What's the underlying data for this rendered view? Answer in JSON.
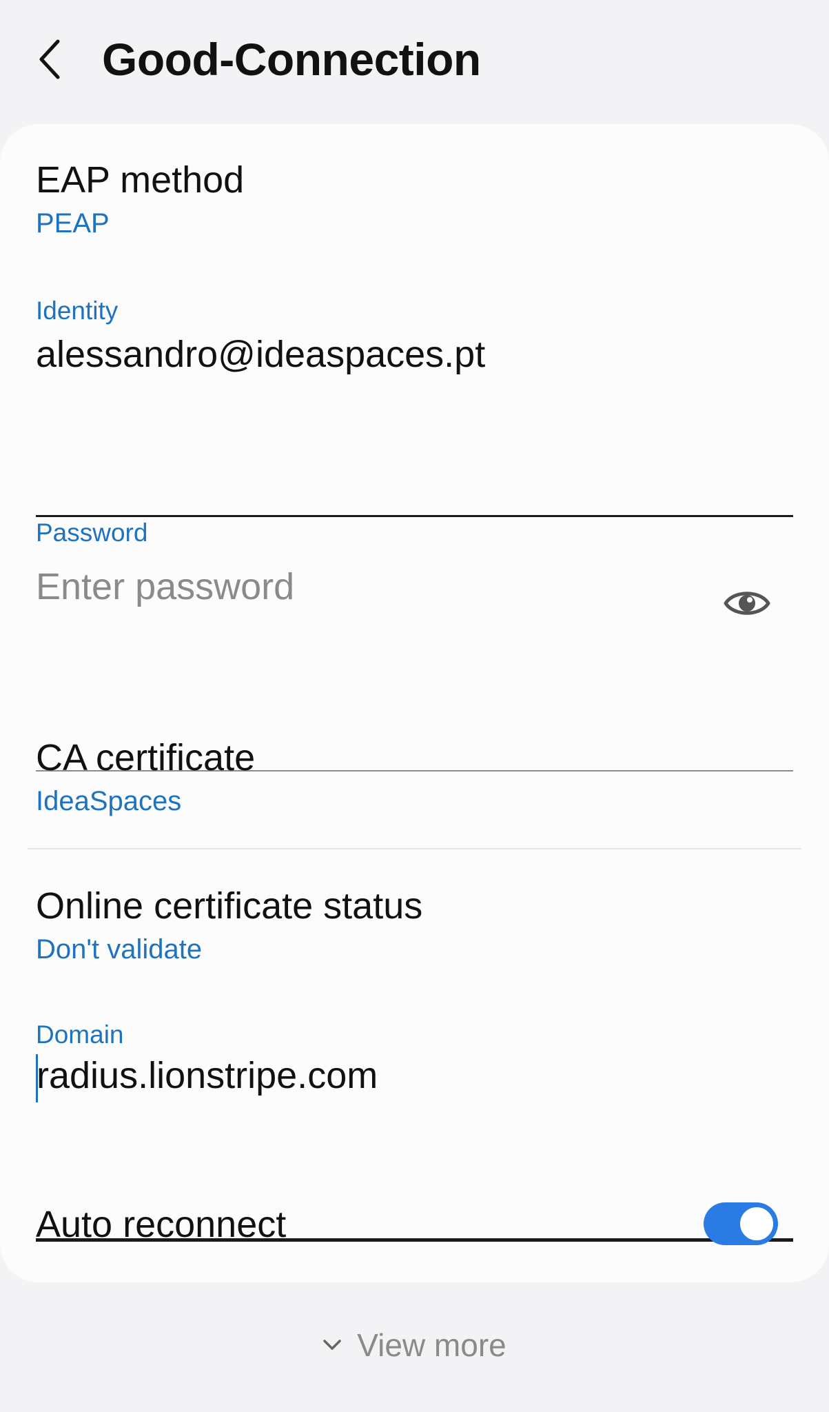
{
  "header": {
    "title": "Good-Connection",
    "back_icon": "chevron-left-icon"
  },
  "eap_method": {
    "label": "EAP method",
    "value": "PEAP"
  },
  "identity": {
    "label": "Identity",
    "value": "alessandro@ideaspaces.pt"
  },
  "password": {
    "label": "Password",
    "placeholder": "Enter password",
    "visibility_icon": "eye-icon"
  },
  "ca_certificate": {
    "label": "CA certificate",
    "value": "IdeaSpaces"
  },
  "online_certificate_status": {
    "label": "Online certificate status",
    "value": "Don't validate"
  },
  "domain": {
    "label": "Domain",
    "value": "radius.lionstripe.com"
  },
  "auto_reconnect": {
    "label": "Auto reconnect",
    "enabled": true
  },
  "footer": {
    "view_more_label": "View more",
    "chevron_icon": "chevron-down-icon"
  },
  "colors": {
    "accent": "#1e73be",
    "toggle_on": "#2a7be4",
    "background": "#f3f3f5",
    "card": "#fcfcfc"
  }
}
